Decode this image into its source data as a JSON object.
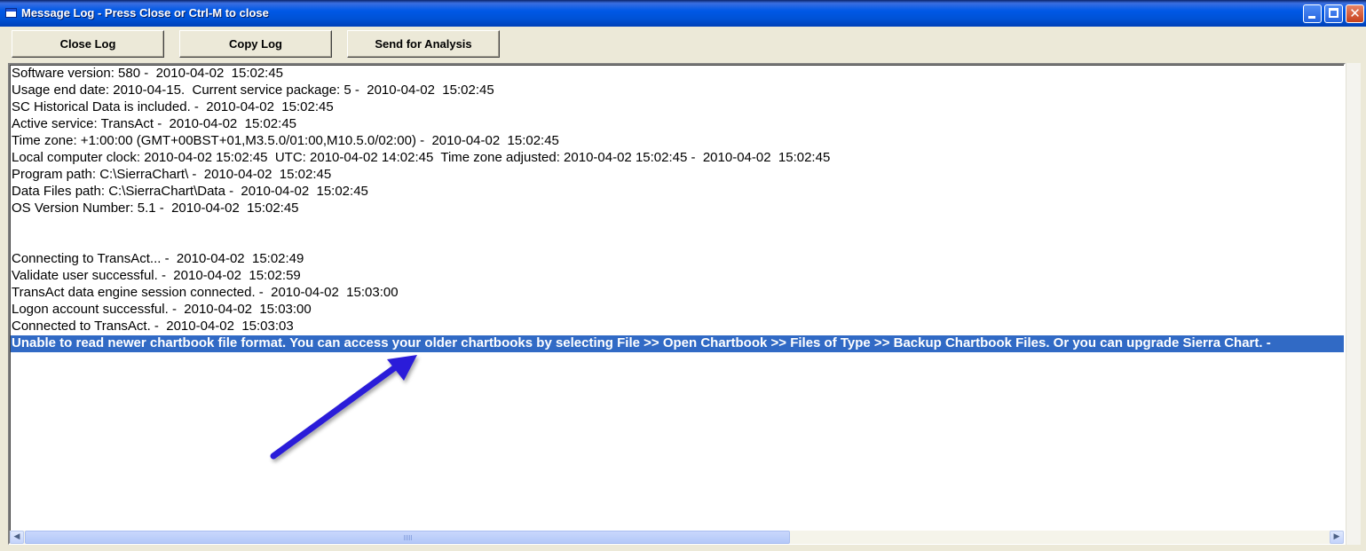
{
  "window": {
    "title": "Message Log - Press Close or Ctrl-M to close",
    "controls": {
      "minimize": "minimize",
      "maximize": "maximize",
      "close_glyph": "✕"
    }
  },
  "toolbar": {
    "close_log": "Close Log",
    "copy_log": "Copy Log",
    "send_for_analysis": "Send for Analysis"
  },
  "log": {
    "lines": [
      "Software version: 580 -  2010-04-02  15:02:45",
      "Usage end date: 2010-04-15.  Current service package: 5 -  2010-04-02  15:02:45",
      "SC Historical Data is included. -  2010-04-02  15:02:45",
      "Active service: TransAct -  2010-04-02  15:02:45",
      "Time zone: +1:00:00 (GMT+00BST+01,M3.5.0/01:00,M10.5.0/02:00) -  2010-04-02  15:02:45",
      "Local computer clock: 2010-04-02 15:02:45  UTC: 2010-04-02 14:02:45  Time zone adjusted: 2010-04-02 15:02:45 -  2010-04-02  15:02:45",
      "Program path: C:\\SierraChart\\ -  2010-04-02  15:02:45",
      "Data Files path: C:\\SierraChart\\Data -  2010-04-02  15:02:45",
      "OS Version Number: 5.1 -  2010-04-02  15:02:45",
      "",
      "",
      "Connecting to TransAct... -  2010-04-02  15:02:49",
      "Validate user successful. -  2010-04-02  15:02:59",
      "TransAct data engine session connected. -  2010-04-02  15:03:00",
      "Logon account successful. -  2010-04-02  15:03:00",
      "Connected to TransAct. -  2010-04-02  15:03:03",
      "Unable to read newer chartbook file format. You can access your older chartbooks by selecting File >> Open Chartbook >> Files of Type >> Backup Chartbook Files. Or you can upgrade Sierra Chart. -"
    ],
    "selected_line_index": 16
  },
  "scrollbar": {
    "left_arrow": "◀",
    "right_arrow": "▶"
  },
  "colors": {
    "selection": "#316AC5",
    "annotation_arrow": "#2B1FD9"
  }
}
